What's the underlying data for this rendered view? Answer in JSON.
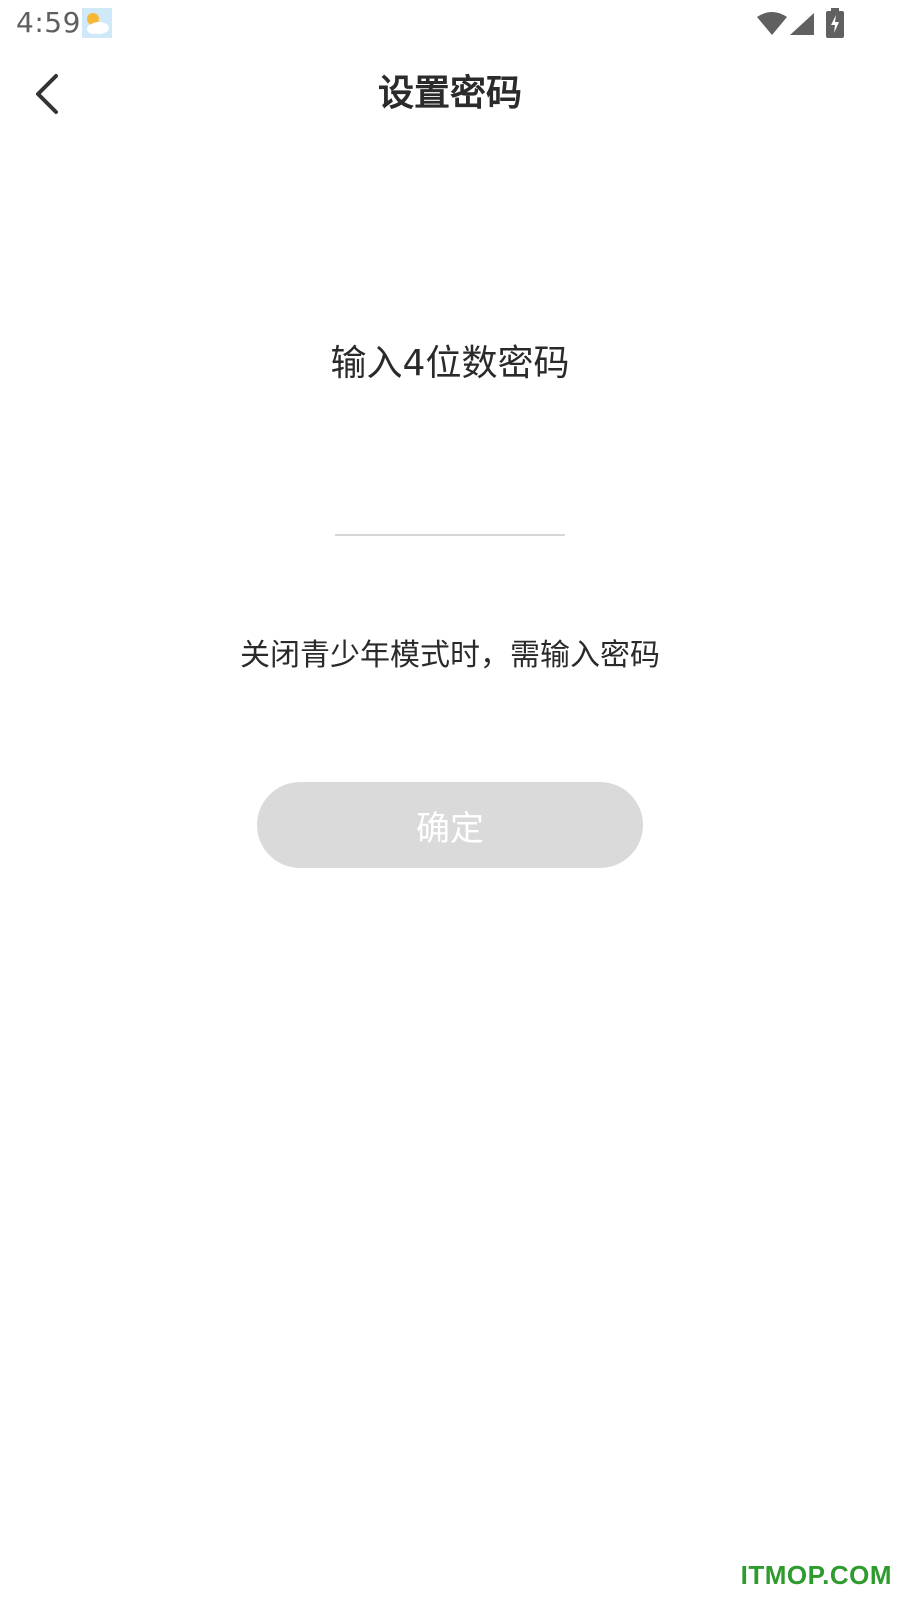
{
  "status_bar": {
    "time": "4:59",
    "icons": [
      "weather-icon",
      "wifi-icon",
      "signal-icon",
      "battery-charging-icon"
    ]
  },
  "top_bar": {
    "title": "设置密码",
    "back_icon": "chevron-left-icon"
  },
  "content": {
    "prompt": "输入4位数密码",
    "pin_value": "",
    "hint": "关闭青少年模式时，需输入密码",
    "confirm_label": "确定"
  },
  "watermark": "ITMOP.COM",
  "colors": {
    "button_bg": "#dadada",
    "button_text": "#ffffff",
    "watermark": "#2e9b2e",
    "underline": "#d6d6d6"
  }
}
